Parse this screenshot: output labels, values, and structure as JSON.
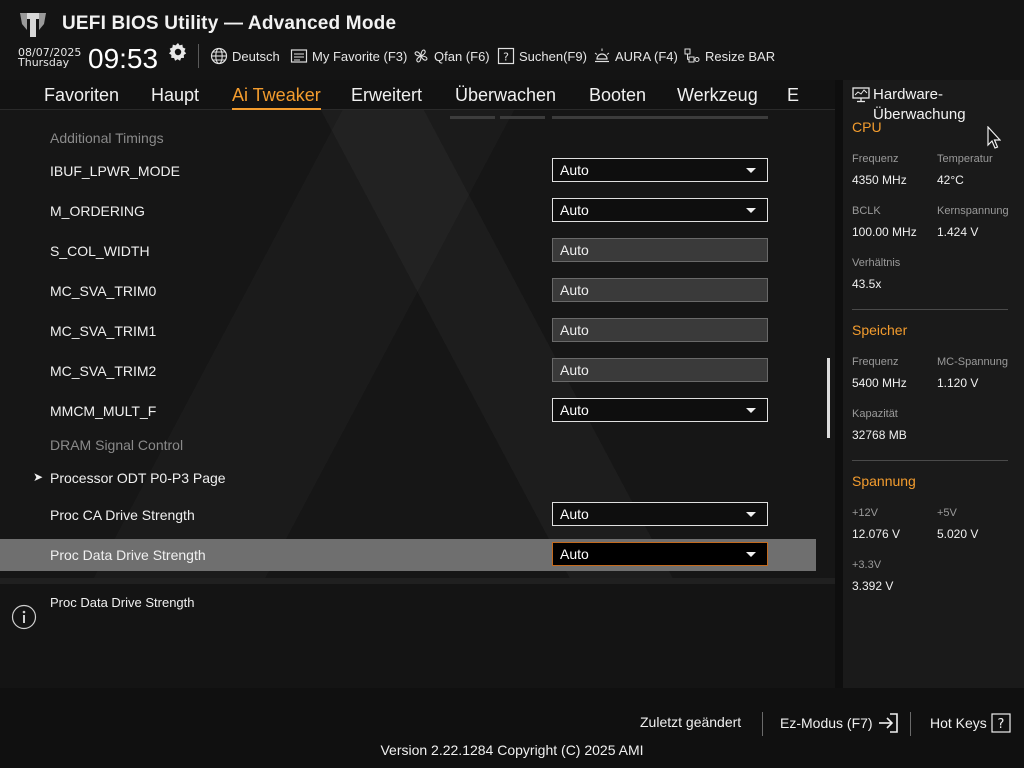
{
  "app": {
    "title": "UEFI BIOS Utility — Advanced Mode"
  },
  "status": {
    "date": "08/07/2025",
    "day": "Thursday",
    "time": "09:53"
  },
  "toolbar": {
    "language": "Deutsch",
    "favorite": "My Favorite (F3)",
    "qfan": "Qfan (F6)",
    "search": "Suchen(F9)",
    "aura": "AURA (F4)",
    "resize_bar": "Resize BAR"
  },
  "nav": {
    "tabs": [
      "Favoriten",
      "Haupt",
      "Ai Tweaker",
      "Erweitert",
      "Überwachen",
      "Booten",
      "Werkzeug",
      "E"
    ],
    "active": "Ai Tweaker"
  },
  "settings": {
    "rows": [
      {
        "label": "Additional Timings",
        "kind": "section"
      },
      {
        "label": "IBUF_LPWR_MODE",
        "value": "Auto",
        "kind": "dropdown"
      },
      {
        "label": "M_ORDERING",
        "value": "Auto",
        "kind": "dropdown"
      },
      {
        "label": "S_COL_WIDTH",
        "value": "Auto",
        "kind": "readonly"
      },
      {
        "label": "MC_SVA_TRIM0",
        "value": "Auto",
        "kind": "readonly"
      },
      {
        "label": "MC_SVA_TRIM1",
        "value": "Auto",
        "kind": "readonly"
      },
      {
        "label": "MC_SVA_TRIM2",
        "value": "Auto",
        "kind": "readonly"
      },
      {
        "label": "MMCM_MULT_F",
        "value": "Auto",
        "kind": "dropdown"
      },
      {
        "label": "DRAM Signal Control",
        "kind": "section"
      },
      {
        "label": "Processor ODT P0-P3 Page",
        "kind": "submenu"
      },
      {
        "label": "Proc CA Drive Strength",
        "value": "Auto",
        "kind": "dropdown"
      },
      {
        "label": "Proc Data Drive Strength",
        "value": "Auto",
        "kind": "dropdown",
        "selected": true
      }
    ]
  },
  "help": {
    "text": "Proc Data Drive Strength"
  },
  "monitor": {
    "title": "Hardware-Überwachung",
    "cpu": {
      "title": "CPU",
      "freq_label": "Frequenz",
      "freq": "4350 MHz",
      "temp_label": "Temperatur",
      "temp": "42°C",
      "bclk_label": "BCLK",
      "bclk": "100.00 MHz",
      "core_label": "Kernspannung",
      "core": "1.424 V",
      "ratio_label": "Verhältnis",
      "ratio": "43.5x"
    },
    "memory": {
      "title": "Speicher",
      "freq_label": "Frequenz",
      "freq": "5400 MHz",
      "mcv_label": "MC-Spannung",
      "mcv": "1.120 V",
      "cap_label": "Kapazität",
      "cap": "32768 MB"
    },
    "voltage": {
      "title": "Spannung",
      "v12_label": "+12V",
      "v12": "12.076 V",
      "v5_label": "+5V",
      "v5": "5.020 V",
      "v33_label": "+3.3V",
      "v33": "3.392 V"
    }
  },
  "bottom": {
    "last_changed": "Zuletzt geändert",
    "ez_mode": "Ez-Modus (F7)",
    "hot_keys": "Hot Keys",
    "version": "Version 2.22.1284 Copyright (C) 2025 AMI"
  },
  "colors": {
    "accent": "#f39c2e",
    "highlight_row": "#6f6f6f",
    "selected_border": "#c36a1e"
  }
}
